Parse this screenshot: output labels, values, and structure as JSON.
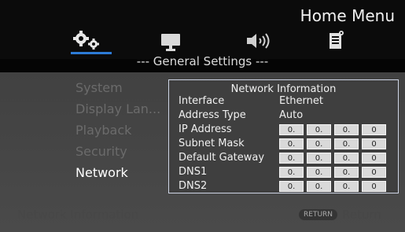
{
  "header": {
    "menu_title": "Home Menu",
    "tabs": [
      {
        "icon": "gears-icon",
        "selected": true
      },
      {
        "icon": "monitor-icon",
        "selected": false
      },
      {
        "icon": "speaker-icon",
        "selected": false
      },
      {
        "icon": "document-icon",
        "selected": false
      }
    ]
  },
  "section_title": "--- General Settings ---",
  "sidebar": {
    "items": [
      {
        "label": "System"
      },
      {
        "label": "Display Lan..."
      },
      {
        "label": "Playback"
      },
      {
        "label": "Security"
      },
      {
        "label": "Network"
      }
    ]
  },
  "network_info": {
    "title": "Network Information",
    "interface_label": "Interface",
    "interface_value": "Ethernet",
    "address_type_label": "Address Type",
    "address_type_value": "Auto",
    "ip_label": "IP Address",
    "ip": [
      "0.",
      "0.",
      "0.",
      "0"
    ],
    "subnet_label": "Subnet Mask",
    "subnet": [
      "0.",
      "0.",
      "0.",
      "0"
    ],
    "gateway_label": "Default Gateway",
    "gateway": [
      "0.",
      "0.",
      "0.",
      "0"
    ],
    "dns1_label": "DNS1",
    "dns1": [
      "0.",
      "0.",
      "0.",
      "0"
    ],
    "dns2_label": "DNS2",
    "dns2": [
      "0.",
      "0.",
      "0.",
      "0"
    ]
  },
  "footer": {
    "left": "Network Information",
    "return_badge": "RETURN",
    "right": "Return"
  },
  "colors": {
    "selection_accent": "#2d7bd6"
  }
}
